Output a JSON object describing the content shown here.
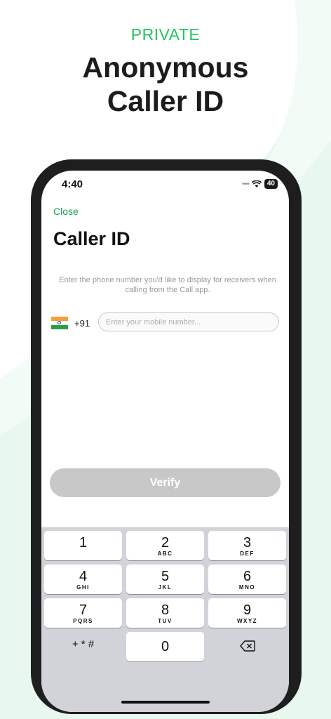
{
  "colors": {
    "accent_green": "#22c55e",
    "link_green": "#1e9e5a",
    "disabled_button": "#c8c8c8",
    "keypad_background": "#d1d3d9"
  },
  "promo": {
    "eyebrow": "PRIVATE",
    "headline_line1": "Anonymous",
    "headline_line2": "Caller ID"
  },
  "status_bar": {
    "time": "4:40",
    "signal_icon": "signal-dots-icon",
    "wifi_icon": "wifi-icon",
    "battery_level": "40"
  },
  "screen": {
    "close_label": "Close",
    "title": "Caller ID",
    "description": "Enter the phone number you'd like to display for receivers when calling from the Call app.",
    "country_flag_icon": "india-flag-icon",
    "dial_code": "+91",
    "phone_input_value": "",
    "phone_input_placeholder": "Enter your mobile number...",
    "verify_label": "Verify"
  },
  "keypad": {
    "keys": [
      {
        "digit": "1",
        "letters": ""
      },
      {
        "digit": "2",
        "letters": "ABC"
      },
      {
        "digit": "3",
        "letters": "DEF"
      },
      {
        "digit": "4",
        "letters": "GHI"
      },
      {
        "digit": "5",
        "letters": "JKL"
      },
      {
        "digit": "6",
        "letters": "MNO"
      },
      {
        "digit": "7",
        "letters": "PQRS"
      },
      {
        "digit": "8",
        "letters": "TUV"
      },
      {
        "digit": "9",
        "letters": "WXYZ"
      }
    ],
    "symbols_label": "+ * #",
    "zero": "0",
    "delete_icon": "backspace-icon"
  }
}
